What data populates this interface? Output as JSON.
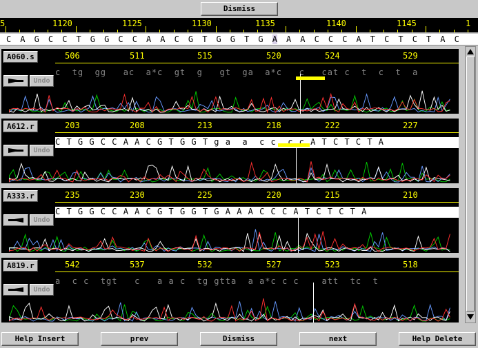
{
  "top_button": "Dismiss",
  "ruler": {
    "labels": [
      "5",
      "1120",
      "1125",
      "1130",
      "1135",
      "1140",
      "1145",
      "1"
    ]
  },
  "consensus": [
    "C",
    "A",
    "G",
    "C",
    "C",
    "T",
    "G",
    "G",
    "C",
    "C",
    "A",
    "A",
    "C",
    "G",
    "T",
    "G",
    "G",
    "T",
    "G",
    "A",
    "A",
    "A",
    "C",
    "C",
    "C",
    "A",
    "T",
    "C",
    "T",
    "C",
    "T",
    "A",
    "C"
  ],
  "panels": [
    {
      "name": "A060.s",
      "undo": "Undo",
      "direction": "forward",
      "numbers": [
        "506",
        "511",
        "515",
        "520",
        "524",
        "529"
      ],
      "bases": "c  tg  gg   ac  a*c  gt  g   gt  ga  a*c   c   cat c  t  c  t  a"
    },
    {
      "name": "A612.r",
      "undo": "Undo",
      "direction": "forward",
      "numbers": [
        "203",
        "208",
        "213",
        "218",
        "222",
        "227"
      ],
      "bases": "C T G G C C A A C G T G G T g a  a  c c  c c A T C T C T A"
    },
    {
      "name": "A333.r",
      "undo": "Undo",
      "direction": "reverse",
      "numbers": [
        "235",
        "230",
        "225",
        "220",
        "215",
        "210"
      ],
      "bases": "C T G G C C A A C G T G G T G A A A C C C A T C T C T A"
    },
    {
      "name": "A819.r",
      "undo": "Undo",
      "direction": "reverse",
      "numbers": [
        "542",
        "537",
        "532",
        "527",
        "523",
        "518"
      ],
      "bases": "a  c c  tgt   c   a a c  tg gtta  a a*c c c    att  tc  t"
    }
  ],
  "bottom_buttons": [
    "Help Insert",
    "prev",
    "Dismiss",
    "next",
    "Help Delete"
  ],
  "colors": {
    "trace_a": "#00cc00",
    "trace_c": "#6699ff",
    "trace_g": "#ffffff",
    "trace_t": "#ff3030",
    "ruler": "#ffff00"
  }
}
